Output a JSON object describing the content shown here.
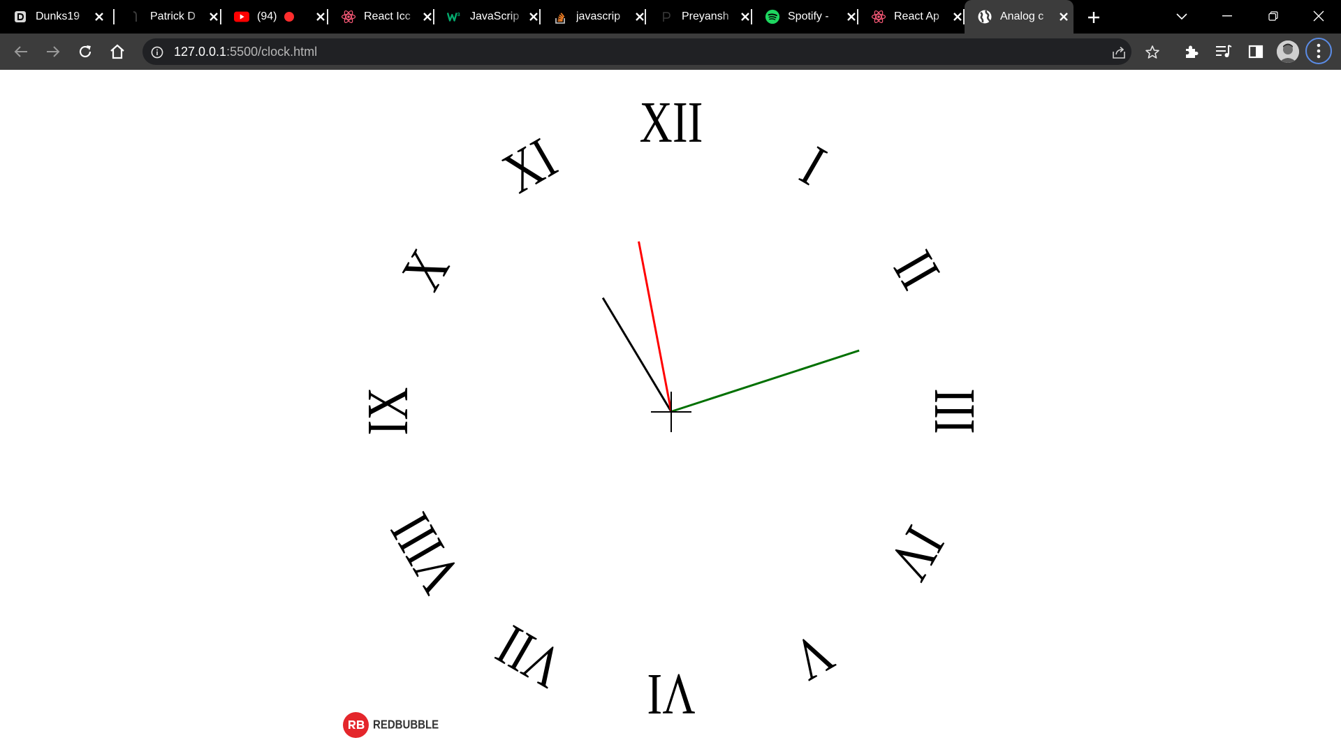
{
  "browser": {
    "tabs": [
      {
        "title": "Dunks19",
        "icon": "dunks-favicon-icon",
        "active": false
      },
      {
        "title": "Patrick D",
        "icon": "patrick-favicon-icon",
        "active": false
      },
      {
        "title": "(94)",
        "icon": "youtube-icon",
        "active": false,
        "recording": true
      },
      {
        "title": "React Icc",
        "icon": "react-icon",
        "active": false
      },
      {
        "title": "JavaScrip",
        "icon": "w3schools-icon",
        "active": false
      },
      {
        "title": "javascrip",
        "icon": "stackoverflow-icon",
        "active": false
      },
      {
        "title": "Preyansh",
        "icon": "preyansh-favicon-icon",
        "active": false
      },
      {
        "title": "Spotify -",
        "icon": "spotify-icon",
        "active": false
      },
      {
        "title": "React Ap",
        "icon": "react-icon",
        "active": false
      },
      {
        "title": "Analog c",
        "icon": "globe-icon",
        "active": true
      }
    ],
    "url_host": "127.0.0.1",
    "url_path": ":5500/clock.html"
  },
  "clock": {
    "numerals": [
      "XII",
      "I",
      "II",
      "III",
      "IV",
      "V",
      "VI",
      "VII",
      "VIII",
      "IX",
      "X",
      "XI"
    ],
    "hands": {
      "hour": {
        "color": "#000000"
      },
      "minute": {
        "color": "#ff0000"
      },
      "second": {
        "color": "#007000"
      }
    },
    "time_shown": {
      "hour": 10,
      "minute": 58,
      "second": 12
    }
  },
  "brand": {
    "name": "REDBUBBLE",
    "color": "#e4262b"
  },
  "colors": {
    "tabstrip": "#000000",
    "toolbar": "#3c3c3c",
    "omnibox": "#202124",
    "page": "#ffffff",
    "menu_ring": "#5b8ce6"
  }
}
